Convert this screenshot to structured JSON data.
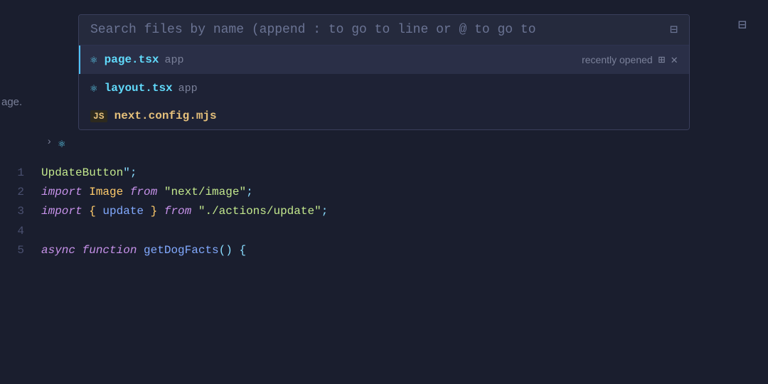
{
  "search": {
    "placeholder": "Search files by name (append : to go to line or @ to go to",
    "input_value": ""
  },
  "layout_icon": "⊞",
  "top_right_icon": "⊟",
  "sidebar": {
    "age_text": "age.",
    "arrow": "›",
    "react_icon": "⚛"
  },
  "file_list": [
    {
      "name": "page.tsx",
      "folder": "app",
      "type": "tsx",
      "icon_type": "react",
      "active": true,
      "badge": "recently opened"
    },
    {
      "name": "layout.tsx",
      "folder": "app",
      "type": "tsx",
      "icon_type": "react",
      "active": false,
      "badge": ""
    },
    {
      "name": "next.config.mjs",
      "folder": "",
      "type": "mjs",
      "icon_type": "js",
      "active": false,
      "badge": ""
    }
  ],
  "code": {
    "lines": [
      {
        "number": "1",
        "content": "UpdateButton\";",
        "tokens": [
          {
            "text": "UpdateButton",
            "class": "update-button"
          },
          {
            "text": "\";",
            "class": "punctuation"
          }
        ]
      },
      {
        "number": "2",
        "content": "import Image from \"next/image\";",
        "tokens": [
          {
            "text": "import ",
            "class": "kw-import"
          },
          {
            "text": "Image ",
            "class": "class-name"
          },
          {
            "text": "from ",
            "class": "kw-from"
          },
          {
            "text": "\"next/image\"",
            "class": "string"
          },
          {
            "text": ";",
            "class": "punctuation"
          }
        ]
      },
      {
        "number": "3",
        "content": "import { update } from \"./actions/update\";",
        "tokens": [
          {
            "text": "import ",
            "class": "kw-import"
          },
          {
            "text": "{ ",
            "class": "brace"
          },
          {
            "text": "update ",
            "class": "identifier"
          },
          {
            "text": "} ",
            "class": "brace"
          },
          {
            "text": "from ",
            "class": "kw-from"
          },
          {
            "text": "\"./actions/update\"",
            "class": "string"
          },
          {
            "text": ";",
            "class": "punctuation"
          }
        ]
      },
      {
        "number": "4",
        "content": "",
        "tokens": []
      },
      {
        "number": "5",
        "content": "async function getDogFacts() {",
        "tokens": [
          {
            "text": "async ",
            "class": "kw-async"
          },
          {
            "text": "function ",
            "class": "kw-function"
          },
          {
            "text": "getDogFacts",
            "class": "fn-name"
          },
          {
            "text": "() {",
            "class": "punctuation"
          }
        ]
      }
    ]
  },
  "colors": {
    "background": "#1a1e2e",
    "sidebar_bg": "#161b2e",
    "search_bg": "#252a3d",
    "active_item": "#2a2f47",
    "accent": "#4fc3f7"
  }
}
